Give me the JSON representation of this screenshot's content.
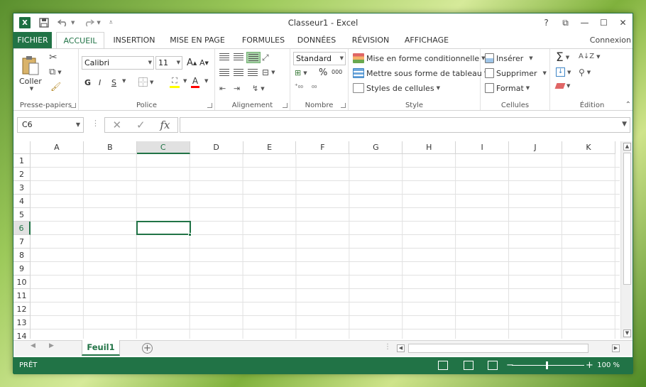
{
  "window": {
    "title": "Classeur1 - Excel",
    "app_icon": "X"
  },
  "qat": {
    "save_icon": "save-icon",
    "undo_icon": "undo-icon",
    "redo_icon": "redo-icon"
  },
  "controls": {
    "help": "?",
    "restore": "⧉",
    "minimize": "—",
    "maximize": "☐",
    "close": "✕"
  },
  "tabs": [
    "FICHIER",
    "ACCUEIL",
    "INSERTION",
    "MISE EN PAGE",
    "FORMULES",
    "DONNÉES",
    "RÉVISION",
    "AFFICHAGE"
  ],
  "account": "Connexion",
  "ribbon": {
    "groups": {
      "clipboard": "Presse-papiers",
      "font": "Police",
      "alignment": "Alignement",
      "number": "Nombre",
      "style": "Style",
      "cells": "Cellules",
      "editing": "Édition"
    },
    "paste_label": "Coller",
    "font_name": "Calibri",
    "font_size": "11",
    "bold": "G",
    "italic": "I",
    "underline": "S",
    "grow_font": "A",
    "shrink_font": "A",
    "number_format": "Standard",
    "percent": "%",
    "thousands": "000",
    "conditional_format": "Mise en forme conditionnelle",
    "format_as_table": "Mettre sous forme de tableau",
    "cell_styles": "Styles de cellules",
    "insert": "Insérer",
    "delete": "Supprimer",
    "format": "Format",
    "sum": "Σ"
  },
  "formula_bar": {
    "name_box": "C6",
    "fx": "fx",
    "value": ""
  },
  "grid": {
    "columns": [
      "A",
      "B",
      "C",
      "D",
      "E",
      "F",
      "G",
      "H",
      "I",
      "J",
      "K"
    ],
    "rows": [
      "1",
      "2",
      "3",
      "4",
      "5",
      "6",
      "7",
      "8",
      "9",
      "10",
      "11",
      "12",
      "13",
      "14"
    ],
    "selected_column": "C",
    "selected_row": "6"
  },
  "sheets": {
    "active": "Feuil1",
    "add": "+"
  },
  "status": {
    "ready": "PRÊT",
    "zoom": "100 %",
    "zoom_minus": "−",
    "zoom_plus": "+"
  },
  "colors": {
    "accent": "#217346",
    "grid": "#e1e1e1"
  }
}
